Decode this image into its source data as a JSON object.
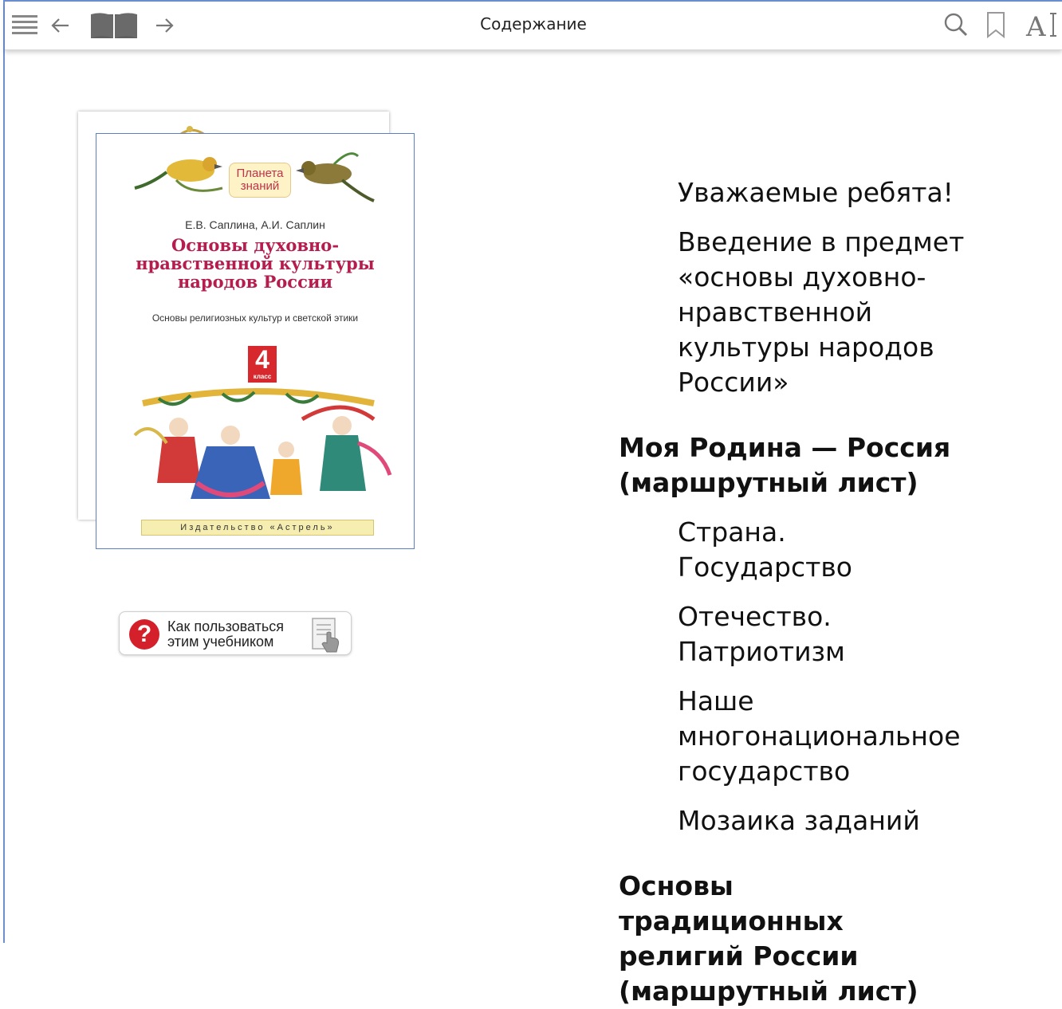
{
  "toolbar": {
    "title": "Содержание",
    "icons": [
      "menu-icon",
      "back-arrow-icon",
      "book-icon",
      "forward-arrow-icon",
      "search-icon",
      "bookmark-icon",
      "font-size-icon"
    ]
  },
  "cover": {
    "series": "Планета знаний",
    "authors": "Е.В. Саплина, А.И. Саплин",
    "title": "Основы духовно-нравственной культуры народов России",
    "subtitle": "Основы религиозных культур и светской этики",
    "grade": "4",
    "grade_label": "класс",
    "publisher": "Издательство «Астрель»"
  },
  "help": {
    "label": "Как пользоваться этим учебником"
  },
  "toc": [
    {
      "type": "item",
      "label": "Уважаемые ребята!"
    },
    {
      "type": "item",
      "label": "Введение в предмет «основы духовно-нравственной культуры народов России»"
    },
    {
      "type": "section",
      "label": "Моя Родина — Россия (маршрутный лист)"
    },
    {
      "type": "item",
      "label": "Страна. Государство"
    },
    {
      "type": "item",
      "label": "Отечество. Патриотизм"
    },
    {
      "type": "item",
      "label": "Наше многонациональное государство"
    },
    {
      "type": "item",
      "label": "Мозаика заданий"
    },
    {
      "type": "section",
      "label": "Основы традиционных религий России (маршрутный лист)"
    }
  ],
  "colors": {
    "accent_border": "#5a7fc6",
    "cover_title": "#b51d4e",
    "help_red": "#d4202a"
  }
}
